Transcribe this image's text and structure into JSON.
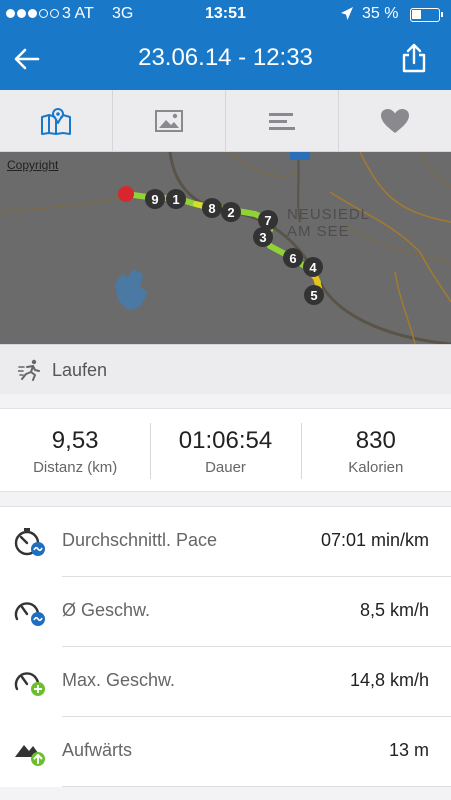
{
  "status_bar": {
    "carrier": "3 AT",
    "network": "3G",
    "time": "13:51",
    "battery": "35 %",
    "battery_level": 0.35,
    "signal_bars_filled": 3,
    "signal_bars_total": 5
  },
  "header": {
    "title": "23.06.14 - 12:33",
    "back_icon": "arrow-left-icon",
    "share_icon": "share-icon"
  },
  "tabs": [
    {
      "icon": "map-pin-icon",
      "active": true
    },
    {
      "icon": "image-icon",
      "active": false
    },
    {
      "icon": "bars-icon",
      "active": false
    },
    {
      "icon": "heart-icon",
      "active": false
    }
  ],
  "map": {
    "copyright": "Copyright",
    "town_line1": "NEUSIEDL",
    "town_line2": "AM SEE",
    "markers": [
      "9",
      "1",
      "8",
      "2",
      "7",
      "3",
      "6",
      "4",
      "5"
    ]
  },
  "activity": {
    "label": "Laufen",
    "icon": "running-icon"
  },
  "summary": [
    {
      "value": "9,53",
      "label": "Distanz (km)"
    },
    {
      "value": "01:06:54",
      "label": "Dauer"
    },
    {
      "value": "830",
      "label": "Kalorien"
    }
  ],
  "stats": [
    {
      "label": "Durchschnittl. Pace",
      "value": "07:01 min/km",
      "icon": "stopwatch-avg-icon"
    },
    {
      "label": "Ø Geschw.",
      "value": "8,5 km/h",
      "icon": "speedometer-avg-icon"
    },
    {
      "label": "Max. Geschw.",
      "value": "14,8 km/h",
      "icon": "speedometer-max-icon"
    },
    {
      "label": "Aufwärts",
      "value": "13 m",
      "icon": "elevation-up-icon"
    }
  ],
  "colors": {
    "brand_blue": "#1a78c8",
    "route_green": "#8fd336",
    "route_yellow": "#e8c21a",
    "start_red": "#d8262f",
    "badge_blue": "#1f6fc1",
    "badge_green": "#6cbf2c"
  }
}
